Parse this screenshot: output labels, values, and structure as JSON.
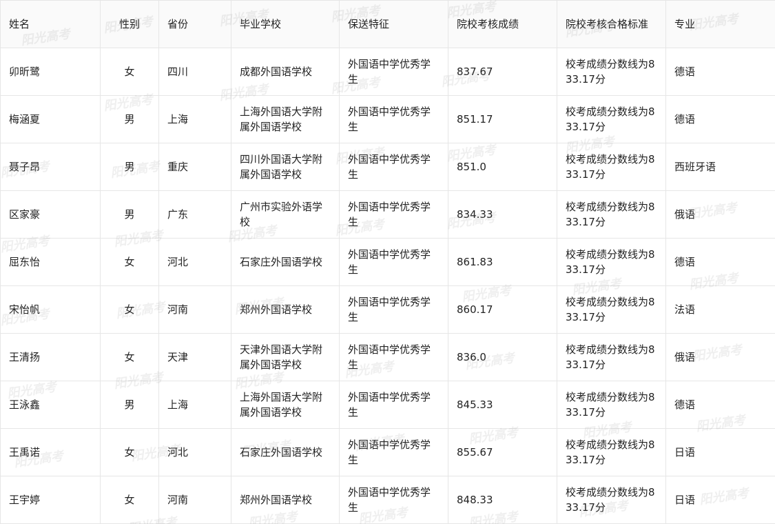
{
  "table": {
    "headers": [
      "姓名",
      "性别",
      "省份",
      "毕业学校",
      "保送特征",
      "院校考核成绩",
      "院校考核合格标准",
      "专业"
    ],
    "rows": [
      [
        "卯昕鹭",
        "女",
        "四川",
        "成都外国语学校",
        "外国语中学优秀学生",
        "837.67",
        "校考成绩分数线为833.17分",
        "德语"
      ],
      [
        "梅涵夏",
        "男",
        "上海",
        "上海外国语大学附属外国语学校",
        "外国语中学优秀学生",
        "851.17",
        "校考成绩分数线为833.17分",
        "德语"
      ],
      [
        "聂子昂",
        "男",
        "重庆",
        "四川外国语大学附属外国语学校",
        "外国语中学优秀学生",
        "851.0",
        "校考成绩分数线为833.17分",
        "西班牙语"
      ],
      [
        "区家豪",
        "男",
        "广东",
        "广州市实验外语学校",
        "外国语中学优秀学生",
        "834.33",
        "校考成绩分数线为833.17分",
        "俄语"
      ],
      [
        "屈东怡",
        "女",
        "河北",
        "石家庄外国语学校",
        "外国语中学优秀学生",
        "861.83",
        "校考成绩分数线为833.17分",
        "德语"
      ],
      [
        "宋怡帆",
        "女",
        "河南",
        "郑州外国语学校",
        "外国语中学优秀学生",
        "860.17",
        "校考成绩分数线为833.17分",
        "法语"
      ],
      [
        "王清扬",
        "女",
        "天津",
        "天津外国语大学附属外国语学校",
        "外国语中学优秀学生",
        "836.0",
        "校考成绩分数线为833.17分",
        "俄语"
      ],
      [
        "王泳鑫",
        "男",
        "上海",
        "上海外国语大学附属外国语学校",
        "外国语中学优秀学生",
        "845.33",
        "校考成绩分数线为833.17分",
        "德语"
      ],
      [
        "王禹诺",
        "女",
        "河北",
        "石家庄外国语学校",
        "外国语中学优秀学生",
        "855.67",
        "校考成绩分数线为833.17分",
        "日语"
      ],
      [
        "王宇婷",
        "女",
        "河南",
        "郑州外国语学校",
        "外国语中学优秀学生",
        "848.33",
        "校考成绩分数线为833.17分",
        "日语"
      ]
    ]
  },
  "watermark": {
    "text": "阳光高考"
  },
  "colors": {
    "border": "#e6e6e6",
    "header_bg": "#fafafa",
    "text": "#222222"
  }
}
